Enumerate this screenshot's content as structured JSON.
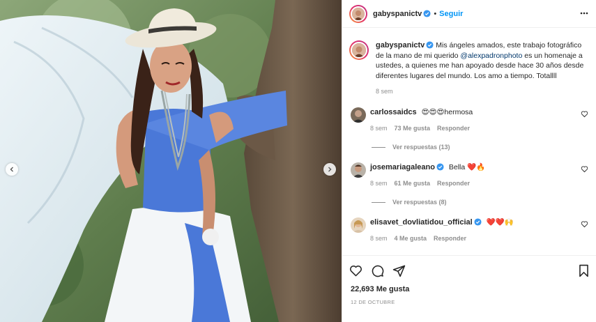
{
  "post": {
    "username": "gabyspanictv",
    "follow_label": "Seguir",
    "caption_text": "Mis ángeles amados, este trabajo fotográfico de la mano de mi querido ",
    "caption_mention": "@alexpadronphoto",
    "caption_rest": " es un homenaje a ustedes, a quienes me han apoyado desde hace 30 años desde diferentes lugares del mundo. Los amo a tiempo. Totallll",
    "caption_time": "8 sem",
    "likes": "22,693 Me gusta",
    "date": "12 DE OCTUBRE"
  },
  "comments": [
    {
      "username": "carlossaidcs",
      "text": "😍😍😍hermosa",
      "time": "8 sem",
      "likes": "73 Me gusta",
      "reply": "Responder",
      "view_replies": "Ver respuestas (13)"
    },
    {
      "username": "josemariagaleano",
      "text": "Bella ❤️🔥",
      "time": "8 sem",
      "likes": "61 Me gusta",
      "reply": "Responder",
      "view_replies": "Ver respuestas (8)"
    },
    {
      "username": "elisavet_dovliatidou_official",
      "text": "❤️❤️🙌",
      "time": "8 sem",
      "likes": "4 Me gusta",
      "reply": "Responder"
    }
  ],
  "icons": {
    "verified": "verified-badge-icon",
    "more": "more-options-icon",
    "like": "heart-icon",
    "comment": "comment-icon",
    "share": "share-icon",
    "save": "bookmark-icon",
    "prev": "chevron-left-icon",
    "next": "chevron-right-icon"
  },
  "colors": {
    "link": "#0095f6",
    "mention": "#00376b",
    "muted": "#8e8e8e",
    "verified": "#3897f0",
    "dress_blue": "#4a78d8"
  }
}
